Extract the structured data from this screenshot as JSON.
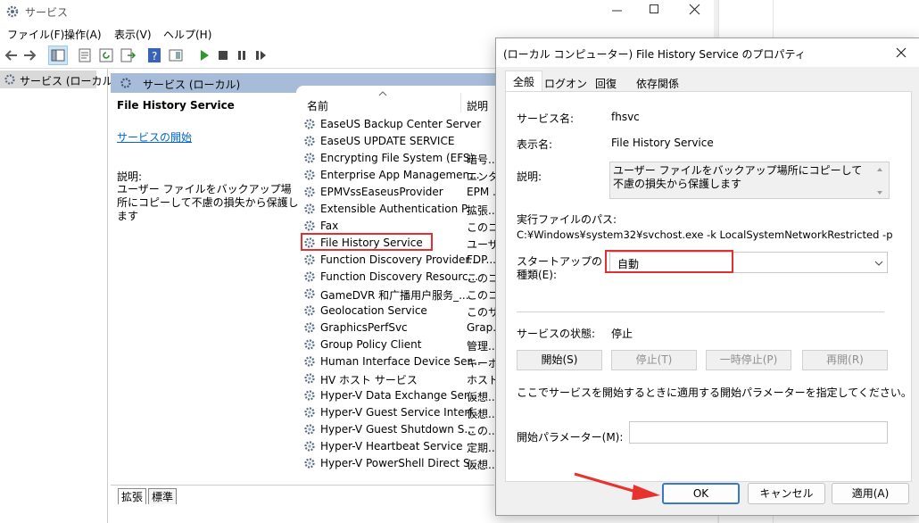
{
  "main_window": {
    "title": "サービス",
    "menu": [
      "ファイル(F)",
      "操作(A)",
      "表示(V)",
      "ヘルプ(H)"
    ],
    "left_tree_item": "サービス (ローカル)",
    "content_header": "サービス (ローカル)",
    "selected_service_title": "File History Service",
    "start_link": "サービスの開始",
    "description_label": "説明:",
    "description_text": "ユーザー ファイルをバックアップ場所にコピーして不慮の損失から保護します",
    "columns": {
      "name": "名前",
      "description": "説明"
    },
    "services": [
      {
        "name": "EaseUS Backup Center Server",
        "desc": ""
      },
      {
        "name": "EaseUS UPDATE SERVICE",
        "desc": ""
      },
      {
        "name": "Encrypting File System (EFS)",
        "desc": "暗号..."
      },
      {
        "name": "Enterprise App Managemen...",
        "desc": "エンタ..."
      },
      {
        "name": "EPMVssEaseusProvider",
        "desc": "EPM ..."
      },
      {
        "name": "Extensible Authentication P...",
        "desc": "拡張..."
      },
      {
        "name": "Fax",
        "desc": "このコ..."
      },
      {
        "name": "File History Service",
        "desc": "ユーザ..."
      },
      {
        "name": "Function Discovery Provider...",
        "desc": "FDP..."
      },
      {
        "name": "Function Discovery Resourc...",
        "desc": "このコ..."
      },
      {
        "name": "GameDVR 和广播用户服务_...",
        "desc": "このコ..."
      },
      {
        "name": "Geolocation Service",
        "desc": "このサ..."
      },
      {
        "name": "GraphicsPerfSvc",
        "desc": "Grap..."
      },
      {
        "name": "Group Policy Client",
        "desc": "管理..."
      },
      {
        "name": "Human Interface Device Ser...",
        "desc": "キーボ..."
      },
      {
        "name": "HV ホスト サービス",
        "desc": "ホスト..."
      },
      {
        "name": "Hyper-V Data Exchange Ser...",
        "desc": "仮想..."
      },
      {
        "name": "Hyper-V Guest Service Interf...",
        "desc": "仮想..."
      },
      {
        "name": "Hyper-V Guest Shutdown S...",
        "desc": "この..."
      },
      {
        "name": "Hyper-V Heartbeat Service",
        "desc": "定期..."
      },
      {
        "name": "Hyper-V PowerShell Direct S...",
        "desc": "仮想..."
      }
    ],
    "bottom_tabs": [
      "拡張",
      "標準"
    ]
  },
  "dialog": {
    "title": "(ローカル コンピューター) File History Service のプロパティ",
    "tabs": [
      "全般",
      "ログオン",
      "回復",
      "依存関係"
    ],
    "service_name_label": "サービス名:",
    "service_name_value": "fhsvc",
    "display_name_label": "表示名:",
    "display_name_value": "File History Service",
    "description_label": "説明:",
    "description_value": "ユーザー ファイルをバックアップ場所にコピーして不慮の損失から保護します",
    "exe_path_label": "実行ファイルのパス:",
    "exe_path_value": "C:¥Windows¥system32¥svchost.exe -k LocalSystemNetworkRestricted -p",
    "startup_label_line1": "スタートアップの",
    "startup_label_line2": "種類(E):",
    "startup_value": "自動",
    "status_label": "サービスの状態:",
    "status_value": "停止",
    "buttons": {
      "start": "開始(S)",
      "stop": "停止(T)",
      "pause": "一時停止(P)",
      "resume": "再開(R)"
    },
    "hint": "ここでサービスを開始するときに適用する開始パラメーターを指定してください。",
    "param_label": "開始パラメーター(M):",
    "param_value": "",
    "ok": "OK",
    "cancel": "キャンセル",
    "apply": "適用(A)"
  },
  "colors": {
    "highlight_box": "#e03030",
    "arrow": "#e8322d",
    "link": "#0066cc",
    "header_band": "#a7bcd9"
  }
}
